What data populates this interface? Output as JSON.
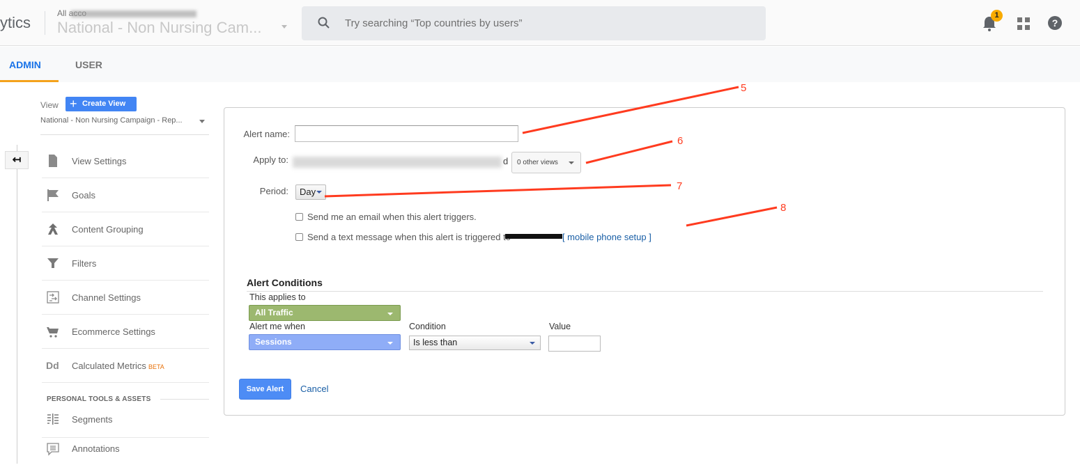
{
  "header": {
    "app_name": "ytics",
    "breadcrumb_prefix": "All acco",
    "account_name": "National - Non Nursing Cam...",
    "search_placeholder": "Try searching “Top countries by users”",
    "notification_count": "1",
    "help_glyph": "?"
  },
  "tabs": [
    {
      "label": "ADMIN",
      "active": true
    },
    {
      "label": "USER",
      "active": false
    }
  ],
  "sidebar": {
    "back_glyph": "↤",
    "view_label": "View",
    "create_view_label": "Create View",
    "view_selected": "National - Non Nursing Campaign - Rep...",
    "items": [
      {
        "label": "View Settings",
        "icon": "document-icon"
      },
      {
        "label": "Goals",
        "icon": "flag-icon"
      },
      {
        "label": "Content Grouping",
        "icon": "content-grouping-icon"
      },
      {
        "label": "Filters",
        "icon": "filter-icon"
      },
      {
        "label": "Channel Settings",
        "icon": "channel-settings-icon"
      },
      {
        "label": "Ecommerce Settings",
        "icon": "cart-icon"
      },
      {
        "label": "Calculated Metrics",
        "icon": "calculated-metrics-icon",
        "badge": "BETA"
      }
    ],
    "section_header": "PERSONAL TOOLS & ASSETS",
    "personal_items": [
      {
        "label": "Segments",
        "icon": "segments-icon"
      },
      {
        "label": "Annotations",
        "icon": "annotations-icon"
      }
    ]
  },
  "form": {
    "alert_name_label": "Alert name:",
    "alert_name_value": "",
    "apply_to_label": "Apply to:",
    "apply_to_suffix": "d",
    "other_views": "0 other views",
    "period_label": "Period:",
    "period_value": "Day",
    "email_checkbox": {
      "label": "Send me an email when this alert triggers.",
      "checked": false
    },
    "sms_checkbox": {
      "label": "Send a text message when this alert is triggered to",
      "checked": false
    },
    "mobile_setup_link": "[ mobile phone setup ]"
  },
  "conditions": {
    "title": "Alert Conditions",
    "applies_to_label": "This applies to",
    "applies_to_value": "All Traffic",
    "alert_when_label": "Alert me when",
    "alert_when_value": "Sessions",
    "condition_label": "Condition",
    "condition_value": "Is less than",
    "value_label": "Value",
    "value_value": ""
  },
  "actions": {
    "save_label": "Save Alert",
    "cancel_label": "Cancel"
  },
  "annotations": [
    "5",
    "6",
    "7",
    "8"
  ],
  "colors": {
    "accent_blue": "#4285f4",
    "tab_active": "#1a73e8",
    "tab_underline": "#f4a21c",
    "segment_green": "#9cb86f",
    "metric_blue": "#8fadf7",
    "annotation_red": "#ff3b1f",
    "badge_yellow": "#f9ab00"
  }
}
